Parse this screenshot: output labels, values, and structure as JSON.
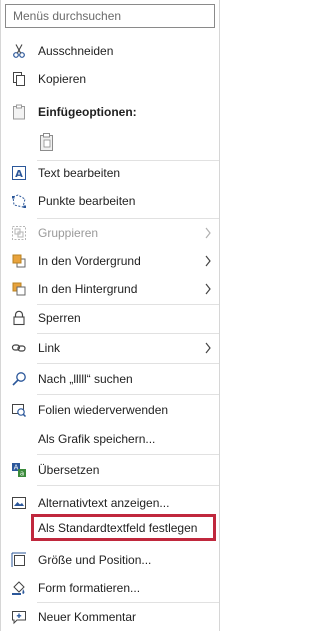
{
  "search": {
    "placeholder": "Menüs durchsuchen"
  },
  "items": {
    "cut": {
      "label": "Ausschneiden",
      "icon": "scissors-icon"
    },
    "copy": {
      "label": "Kopieren",
      "icon": "copy-icon"
    },
    "paste_header": {
      "label": "Einfügeoptionen:",
      "icon": "clipboard-icon"
    },
    "paste_option": {
      "icon": "paste-keep-icon"
    },
    "edit_text": {
      "label": "Text bearbeiten",
      "icon": "text-box-icon"
    },
    "edit_points": {
      "label": "Punkte bearbeiten",
      "icon": "edit-points-icon"
    },
    "group": {
      "label": "Gruppieren",
      "icon": "group-icon",
      "disabled": true
    },
    "bring_front": {
      "label": "In den Vordergrund",
      "icon": "bring-forward-icon"
    },
    "send_back": {
      "label": "In den Hintergrund",
      "icon": "send-backward-icon"
    },
    "lock": {
      "label": "Sperren",
      "icon": "lock-icon"
    },
    "link": {
      "label": "Link",
      "icon": "link-icon"
    },
    "search_for": {
      "label": "Nach „lllll“ suchen",
      "icon": "search-icon"
    },
    "reuse_slides": {
      "label": "Folien wiederverwenden",
      "icon": "reuse-slides-icon"
    },
    "save_as_picture": {
      "label": "Als Grafik speichern..."
    },
    "translate": {
      "label": "Übersetzen",
      "icon": "translate-icon"
    },
    "alt_text": {
      "label": "Alternativtext anzeigen...",
      "icon": "alt-text-icon"
    },
    "set_default": {
      "label": "Als Standardtextfeld festlegen"
    },
    "size_position": {
      "label": "Größe und Position...",
      "icon": "size-position-icon"
    },
    "format_shape": {
      "label": "Form formatieren...",
      "icon": "format-shape-icon"
    },
    "new_comment": {
      "label": "Neuer Kommentar",
      "icon": "new-comment-icon"
    }
  },
  "colors": {
    "accent": "#2b579a",
    "highlight": "#c0283d",
    "orange": "#e8a33d"
  }
}
